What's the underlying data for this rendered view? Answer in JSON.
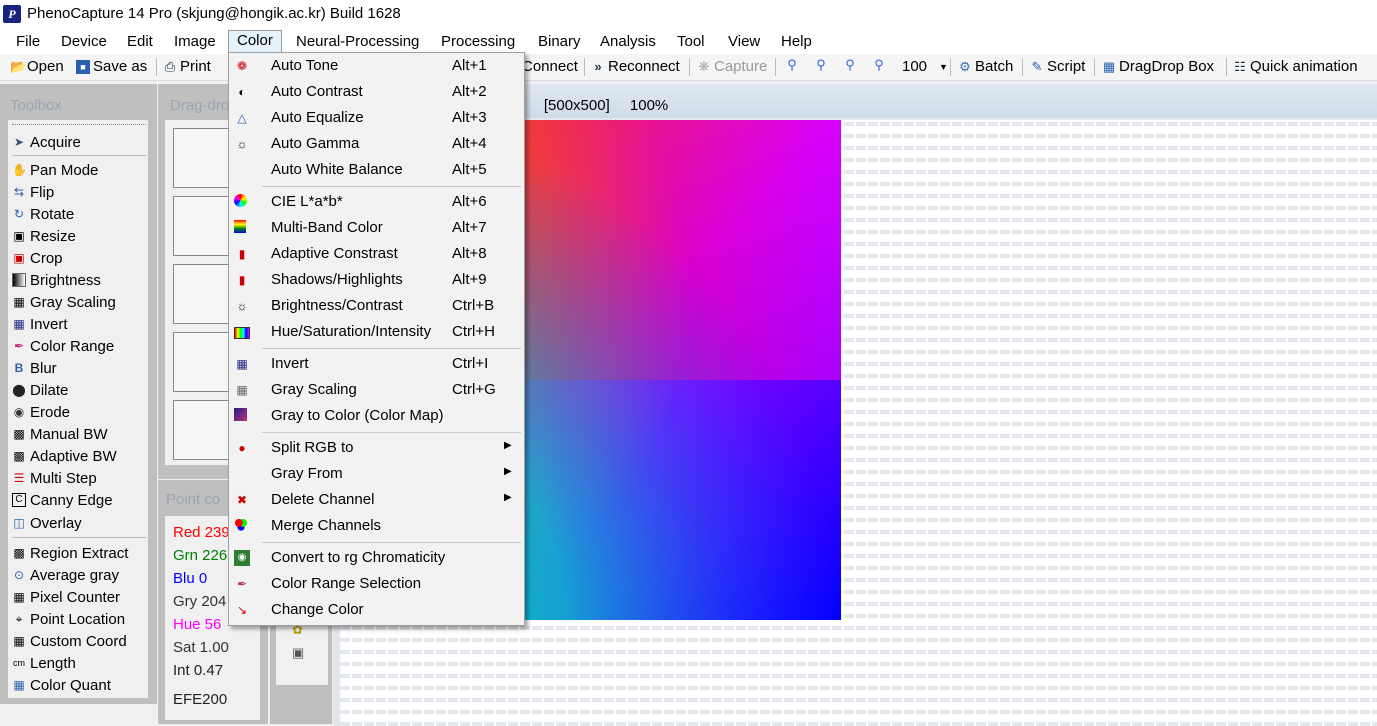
{
  "window": {
    "title": "PhenoCapture 14 Pro (skjung@hongik.ac.kr)  Build 1628"
  },
  "menubar": [
    "File",
    "Device",
    "Edit",
    "Image",
    "Color",
    "Neural-Processing",
    "Processing",
    "Binary",
    "Analysis",
    "Tool",
    "View",
    "Help"
  ],
  "toolbar": {
    "open": "Open",
    "save_as": "Save as",
    "print": "Print",
    "connect": "Connect",
    "reconnect": "Reconnect",
    "capture": "Capture",
    "zoom": "100",
    "batch": "Batch",
    "script": "Script",
    "dragdrop": "DragDrop Box",
    "quick_animation": "Quick animation"
  },
  "toolbox": {
    "title": "Toolbox",
    "group1": [
      "Acquire"
    ],
    "group2": [
      "Pan Mode",
      "Flip",
      "Rotate",
      "Resize",
      "Crop",
      "Brightness",
      "Gray Scaling",
      "Invert",
      "Color Range",
      "Blur",
      "Dilate",
      "Erode",
      "Manual BW",
      "Adaptive BW",
      "Multi Step",
      "Canny Edge",
      "Overlay"
    ],
    "group3": [
      "Region Extract",
      "Average gray",
      "Pixel Counter",
      "Point Location",
      "Custom Coord",
      "Length",
      "Color Quant"
    ]
  },
  "dragdrop": {
    "title": "Drag-dro"
  },
  "point_color": {
    "title": "Point co",
    "red": "Red 239",
    "grn": "Grn 226",
    "blu": "Blu 0",
    "gry": "Gry 204",
    "hue": "Hue 56",
    "sat": "Sat 1.00",
    "int": "Int 0.47",
    "hex": "EFE200",
    "colors": {
      "red": "#ff0000",
      "grn": "#008000",
      "blu": "#0000ff",
      "hue": "#ff00ff"
    }
  },
  "image": {
    "name_fragment": "o\"",
    "size": "[500x500]",
    "zoom": "100%"
  },
  "color_menu": {
    "items": [
      {
        "label": "Auto Tone",
        "shortcut": "Alt+1",
        "icon": "auto-tone-icon"
      },
      {
        "label": "Auto Contrast",
        "shortcut": "Alt+2",
        "icon": "auto-contrast-icon"
      },
      {
        "label": "Auto Equalize",
        "shortcut": "Alt+3",
        "icon": "auto-equalize-icon"
      },
      {
        "label": "Auto Gamma",
        "shortcut": "Alt+4",
        "icon": "auto-gamma-icon"
      },
      {
        "label": "Auto White Balance",
        "shortcut": "Alt+5",
        "icon": "white-balance-icon"
      },
      {
        "label": "CIE L*a*b*",
        "shortcut": "Alt+6",
        "icon": "color-wheel-icon"
      },
      {
        "label": "Multi-Band Color",
        "shortcut": "Alt+7",
        "icon": "multi-band-icon"
      },
      {
        "label": "Adaptive Constrast",
        "shortcut": "Alt+8",
        "icon": "adaptive-icon"
      },
      {
        "label": "Shadows/Highlights",
        "shortcut": "Alt+9",
        "icon": "shadows-icon"
      },
      {
        "label": "Brightness/Contrast",
        "shortcut": "Ctrl+B",
        "icon": "sun-icon"
      },
      {
        "label": "Hue/Saturation/Intensity",
        "shortcut": "Ctrl+H",
        "icon": "hue-icon"
      },
      {
        "label": "Invert",
        "shortcut": "Ctrl+I",
        "icon": "invert-icon"
      },
      {
        "label": "Gray Scaling",
        "shortcut": "Ctrl+G",
        "icon": "gray-icon"
      },
      {
        "label": "Gray to Color (Color Map)",
        "shortcut": "",
        "icon": "color-map-icon"
      },
      {
        "label": "Split RGB to",
        "shortcut": "",
        "icon": "split-rgb-icon"
      },
      {
        "label": "Gray From",
        "shortcut": "",
        "icon": ""
      },
      {
        "label": "Delete Channel",
        "shortcut": "",
        "icon": "delete-channel-icon"
      },
      {
        "label": "Merge Channels",
        "shortcut": "",
        "icon": "merge-channels-icon"
      },
      {
        "label": "Convert to rg Chromaticity",
        "shortcut": "",
        "icon": "chromaticity-icon"
      },
      {
        "label": "Color Range Selection",
        "shortcut": "",
        "icon": "eyedropper-icon"
      },
      {
        "label": "Change Color",
        "shortcut": "",
        "icon": "change-color-icon"
      }
    ]
  }
}
